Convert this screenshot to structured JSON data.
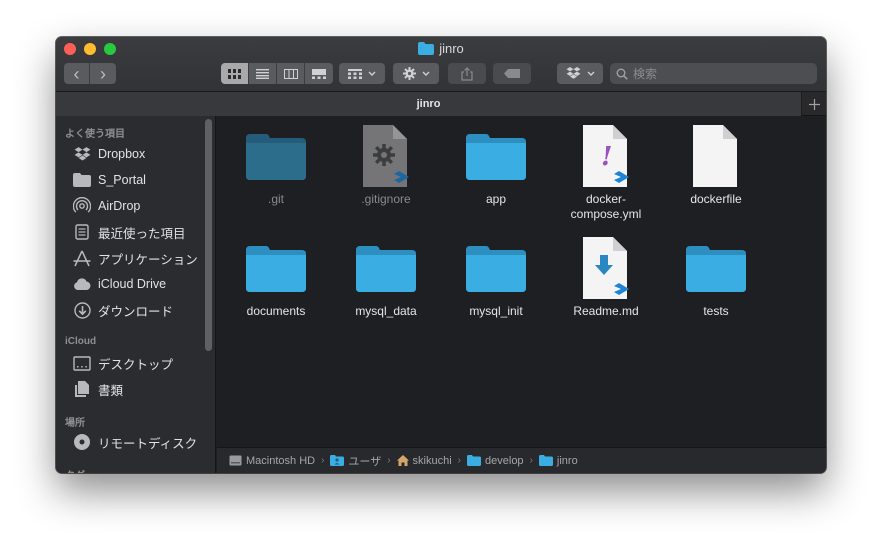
{
  "window": {
    "title": "jinro"
  },
  "toolbar": {
    "back": "‹",
    "forward": "›",
    "search_placeholder": "検索"
  },
  "tabs": [
    {
      "label": "jinro"
    }
  ],
  "sidebar": {
    "sections": [
      {
        "header": "よく使う項目",
        "items": [
          {
            "label": "Dropbox",
            "icon": "dropbox-icon"
          },
          {
            "label": "S_Portal",
            "icon": "folder-icon"
          },
          {
            "label": "AirDrop",
            "icon": "airdrop-icon"
          },
          {
            "label": "最近使った項目",
            "icon": "recents-icon"
          },
          {
            "label": "アプリケーション",
            "icon": "applications-icon"
          },
          {
            "label": "iCloud Drive",
            "icon": "cloud-icon"
          },
          {
            "label": "ダウンロード",
            "icon": "download-icon"
          }
        ]
      },
      {
        "header": "iCloud",
        "items": [
          {
            "label": "デスクトップ",
            "icon": "desktop-icon"
          },
          {
            "label": "書類",
            "icon": "documents-icon"
          }
        ]
      },
      {
        "header": "場所",
        "items": [
          {
            "label": "リモートディスク",
            "icon": "disc-icon"
          }
        ]
      },
      {
        "header": "タグ",
        "items": []
      }
    ]
  },
  "files": [
    {
      "name": ".git",
      "kind": "folder",
      "hidden": true
    },
    {
      "name": ".gitignore",
      "kind": "gear-doc",
      "hidden": true
    },
    {
      "name": "app",
      "kind": "folder",
      "hidden": false
    },
    {
      "name": "docker-\ncompose.yml",
      "kind": "yml-doc",
      "hidden": false
    },
    {
      "name": "dockerfile",
      "kind": "blank-doc",
      "hidden": false
    },
    {
      "name": "documents",
      "kind": "folder",
      "hidden": false
    },
    {
      "name": "mysql_data",
      "kind": "folder",
      "hidden": false
    },
    {
      "name": "mysql_init",
      "kind": "folder",
      "hidden": false
    },
    {
      "name": "Readme.md",
      "kind": "md-doc",
      "hidden": false
    },
    {
      "name": "tests",
      "kind": "folder",
      "hidden": false
    }
  ],
  "pathbar": [
    {
      "label": "Macintosh HD",
      "icon": "hard-drive-icon"
    },
    {
      "label": "ユーザ",
      "icon": "users-folder-icon"
    },
    {
      "label": "skikuchi",
      "icon": "home-icon"
    },
    {
      "label": "develop",
      "icon": "folder-icon"
    },
    {
      "label": "jinro",
      "icon": "folder-icon"
    }
  ],
  "colors": {
    "folder": "#3aaee3",
    "folder_dark": "#2c8fc0",
    "accent": "#1e84d6"
  }
}
